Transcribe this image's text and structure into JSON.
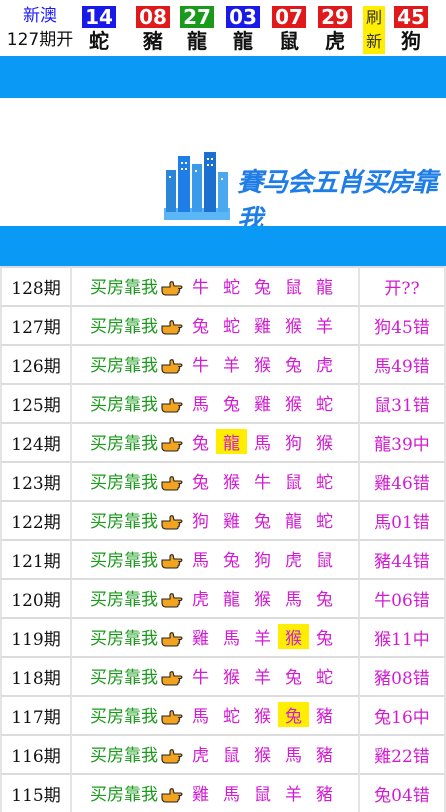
{
  "header": {
    "site": "新澳",
    "issue": "127期开",
    "refresh": [
      "刷",
      "新"
    ],
    "balls": [
      {
        "num": "14",
        "zodiac": "蛇",
        "color": "#1a1ae8"
      },
      {
        "num": "08",
        "zodiac": "豬",
        "color": "#e01a1a"
      },
      {
        "num": "27",
        "zodiac": "龍",
        "color": "#1a9a1a"
      },
      {
        "num": "03",
        "zodiac": "龍",
        "color": "#1a1ae8"
      },
      {
        "num": "07",
        "zodiac": "鼠",
        "color": "#e01a1a"
      },
      {
        "num": "29",
        "zodiac": "虎",
        "color": "#e01a1a"
      },
      {
        "num": "45",
        "zodiac": "狗",
        "color": "#e01a1a"
      }
    ]
  },
  "banner": {
    "brand": "賽马会五肖买房靠我"
  },
  "colors": {
    "accent_blue": "#0a9af5",
    "green": "#1a9a1a",
    "magenta": "#d41bd4",
    "highlight": "#ffee00"
  },
  "slogan": "买房靠我",
  "rows": [
    {
      "issue": "128期",
      "picks": [
        "牛",
        "蛇",
        "兔",
        "鼠",
        "龍"
      ],
      "hit": -1,
      "result": "开??"
    },
    {
      "issue": "127期",
      "picks": [
        "兔",
        "蛇",
        "雞",
        "猴",
        "羊"
      ],
      "hit": -1,
      "result": "狗45错"
    },
    {
      "issue": "126期",
      "picks": [
        "牛",
        "羊",
        "猴",
        "兔",
        "虎"
      ],
      "hit": -1,
      "result": "馬49错"
    },
    {
      "issue": "125期",
      "picks": [
        "馬",
        "兔",
        "雞",
        "猴",
        "蛇"
      ],
      "hit": -1,
      "result": "鼠31错"
    },
    {
      "issue": "124期",
      "picks": [
        "兔",
        "龍",
        "馬",
        "狗",
        "猴"
      ],
      "hit": 1,
      "result": "龍39中"
    },
    {
      "issue": "123期",
      "picks": [
        "兔",
        "猴",
        "牛",
        "鼠",
        "蛇"
      ],
      "hit": -1,
      "result": "雞46错"
    },
    {
      "issue": "122期",
      "picks": [
        "狗",
        "雞",
        "兔",
        "龍",
        "蛇"
      ],
      "hit": -1,
      "result": "馬01错"
    },
    {
      "issue": "121期",
      "picks": [
        "馬",
        "兔",
        "狗",
        "虎",
        "鼠"
      ],
      "hit": -1,
      "result": "豬44错"
    },
    {
      "issue": "120期",
      "picks": [
        "虎",
        "龍",
        "猴",
        "馬",
        "兔"
      ],
      "hit": -1,
      "result": "牛06错"
    },
    {
      "issue": "119期",
      "picks": [
        "雞",
        "馬",
        "羊",
        "猴",
        "兔"
      ],
      "hit": 3,
      "result": "猴11中"
    },
    {
      "issue": "118期",
      "picks": [
        "牛",
        "猴",
        "羊",
        "兔",
        "蛇"
      ],
      "hit": -1,
      "result": "豬08错"
    },
    {
      "issue": "117期",
      "picks": [
        "馬",
        "蛇",
        "猴",
        "兔",
        "豬"
      ],
      "hit": 3,
      "result": "兔16中"
    },
    {
      "issue": "116期",
      "picks": [
        "虎",
        "鼠",
        "猴",
        "馬",
        "豬"
      ],
      "hit": -1,
      "result": "雞22错"
    },
    {
      "issue": "115期",
      "picks": [
        "雞",
        "馬",
        "鼠",
        "羊",
        "豬"
      ],
      "hit": -1,
      "result": "兔04错"
    }
  ]
}
